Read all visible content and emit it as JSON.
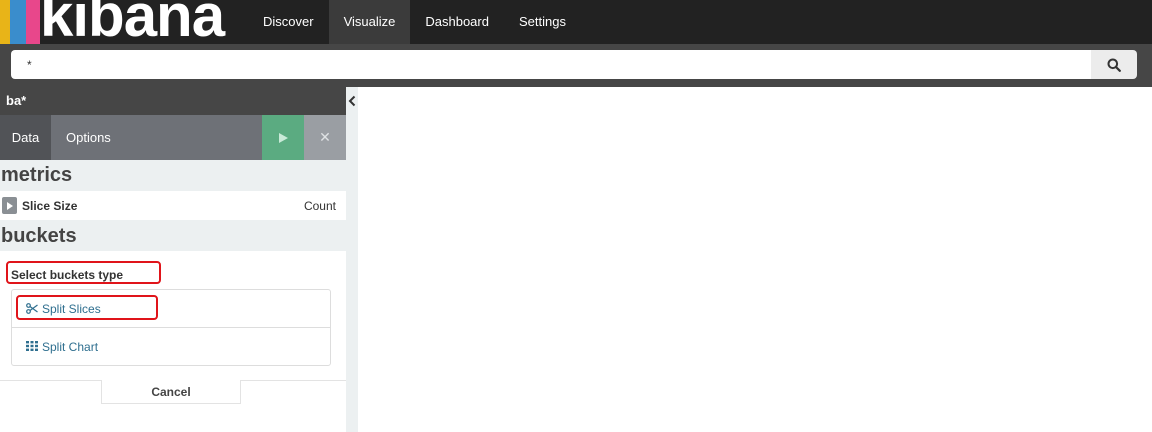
{
  "app": {
    "logo_text": "kibana"
  },
  "colors": {
    "stripe_yellow": "#e8b418",
    "stripe_blue": "#3a8dcc",
    "stripe_pink": "#e8478b",
    "topbar": "#222222",
    "apply_green": "#5bab81",
    "highlight_red": "#e0141a"
  },
  "nav": {
    "items": [
      {
        "label": "Discover",
        "active": false
      },
      {
        "label": "Visualize",
        "active": true
      },
      {
        "label": "Dashboard",
        "active": false
      },
      {
        "label": "Settings",
        "active": false
      }
    ]
  },
  "search": {
    "value": "*",
    "icon": "search-icon"
  },
  "sidebar": {
    "index_pattern": "ba*",
    "tabs": [
      {
        "label": "Data",
        "active": true
      },
      {
        "label": "Options",
        "active": false
      }
    ],
    "apply_icon": "play-icon",
    "discard_icon": "close-icon",
    "metrics": {
      "title": "metrics",
      "items": [
        {
          "label": "Slice Size",
          "aggregation": "Count"
        }
      ]
    },
    "buckets": {
      "title": "buckets",
      "select_label": "Select buckets type",
      "types": [
        {
          "label": "Split Slices",
          "icon": "scissors-icon"
        },
        {
          "label": "Split Chart",
          "icon": "grid-icon"
        }
      ],
      "cancel_label": "Cancel"
    }
  }
}
